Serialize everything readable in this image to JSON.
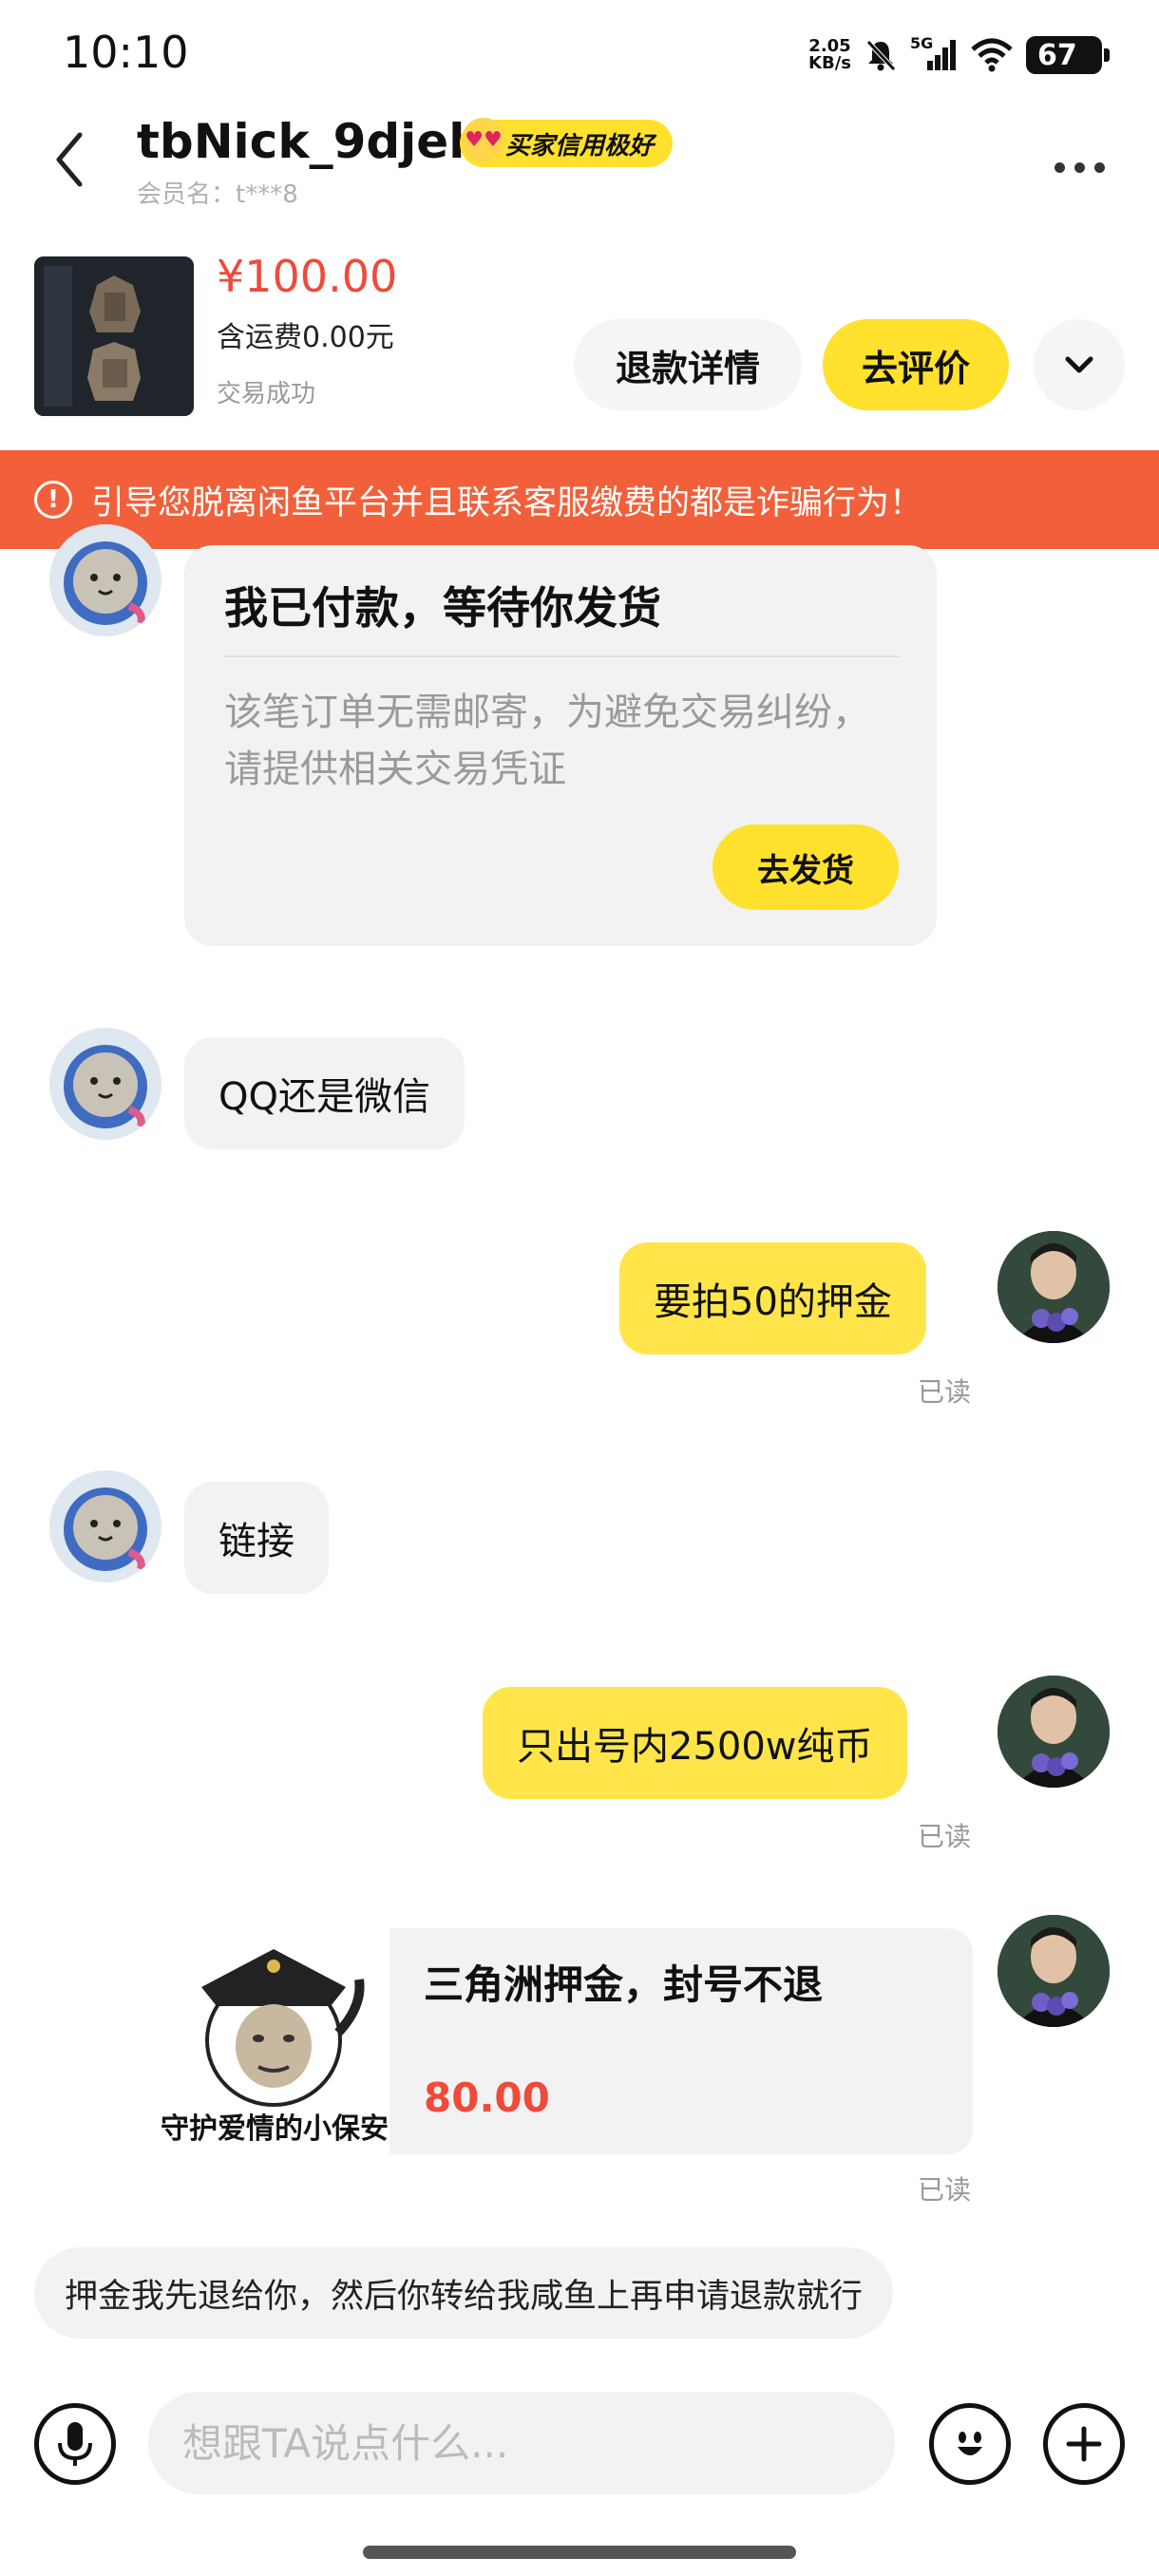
{
  "status_bar": {
    "time": "10:10",
    "net_speed_value": "2.05",
    "net_speed_unit": "KB/s",
    "network": "5G",
    "battery": "67"
  },
  "header": {
    "nickname": "tbNick_9djeh",
    "credit_badge": "买家信用极好",
    "member_label": "会员名：t***8",
    "icons": {
      "back": "chevron-left-icon",
      "more": "more-dots-icon"
    }
  },
  "product": {
    "price": "¥100.00",
    "shipping": "含运费0.00元",
    "status": "交易成功",
    "refund_button": "退款详情",
    "review_button": "去评价"
  },
  "warning": {
    "text": "引导您脱离闲鱼平台并且联系客服缴费的都是诈骗行为！",
    "color": "#f1603a"
  },
  "messages": {
    "payment_card": {
      "title": "我已付款，等待你发货",
      "desc": "该笔订单无需邮寄，为避免交易纠纷，请提供相关交易凭证",
      "button": "去发货"
    },
    "msg1": "QQ还是微信",
    "msg2": "要拍50的押金",
    "msg2_read": "已读",
    "msg3": "链接",
    "msg4": "只出号内2500w纯币",
    "msg4_read": "已读",
    "link_card": {
      "image_caption": "守护爱情的小保安",
      "title": "三角洲押金，封号不退",
      "price": "80.00"
    },
    "link_card_read": "已读"
  },
  "quick_reply": "押金我先退给你，然后你转给我咸鱼上再申请退款就行",
  "input": {
    "placeholder": "想跟TA说点什么..."
  },
  "colors": {
    "accent_yellow": "#ffe12e",
    "price_red": "#ef4a3a",
    "bubble_gray": "#f2f2f3"
  }
}
